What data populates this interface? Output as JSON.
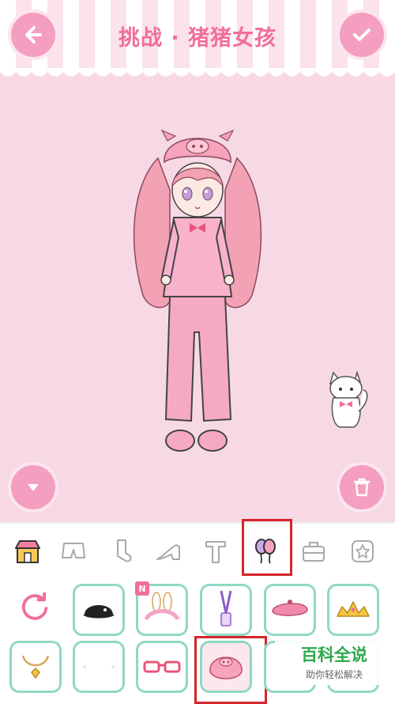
{
  "header": {
    "title": "挑战 · 猪猪女孩",
    "back_icon": "arrow-left-icon",
    "confirm_icon": "check-icon"
  },
  "colors": {
    "pink_accent": "#f49fbf",
    "title_pink": "#f06e9c",
    "background": "#f7d9e6",
    "cell_border": "#8fd9c2",
    "highlight": "#d3252d"
  },
  "canvas": {
    "collapse_icon": "chevron-down-icon",
    "delete_icon": "trash-icon"
  },
  "tabs": [
    {
      "icon": "shop-icon",
      "selected": false
    },
    {
      "icon": "shorts-icon",
      "selected": false
    },
    {
      "icon": "sock-icon",
      "selected": false
    },
    {
      "icon": "high-heel-icon",
      "selected": false
    },
    {
      "icon": "t-icon",
      "selected": false
    },
    {
      "icon": "balloons-icon",
      "selected": true
    },
    {
      "icon": "bag-icon",
      "selected": false
    },
    {
      "icon": "star-icon",
      "selected": false
    }
  ],
  "items": {
    "reset_icon": "refresh-icon",
    "new_badge": "N",
    "row1": [
      "black-cap",
      "bunny-headband",
      "lanyard-tag",
      "pink-beret",
      "gold-tiara"
    ],
    "row2": [
      "gold-necklace",
      "empty",
      "pink-glasses",
      "pig-hood",
      "partial-item"
    ]
  },
  "watermark": {
    "title": "百科全说",
    "subtitle": "助你轻松解决"
  }
}
